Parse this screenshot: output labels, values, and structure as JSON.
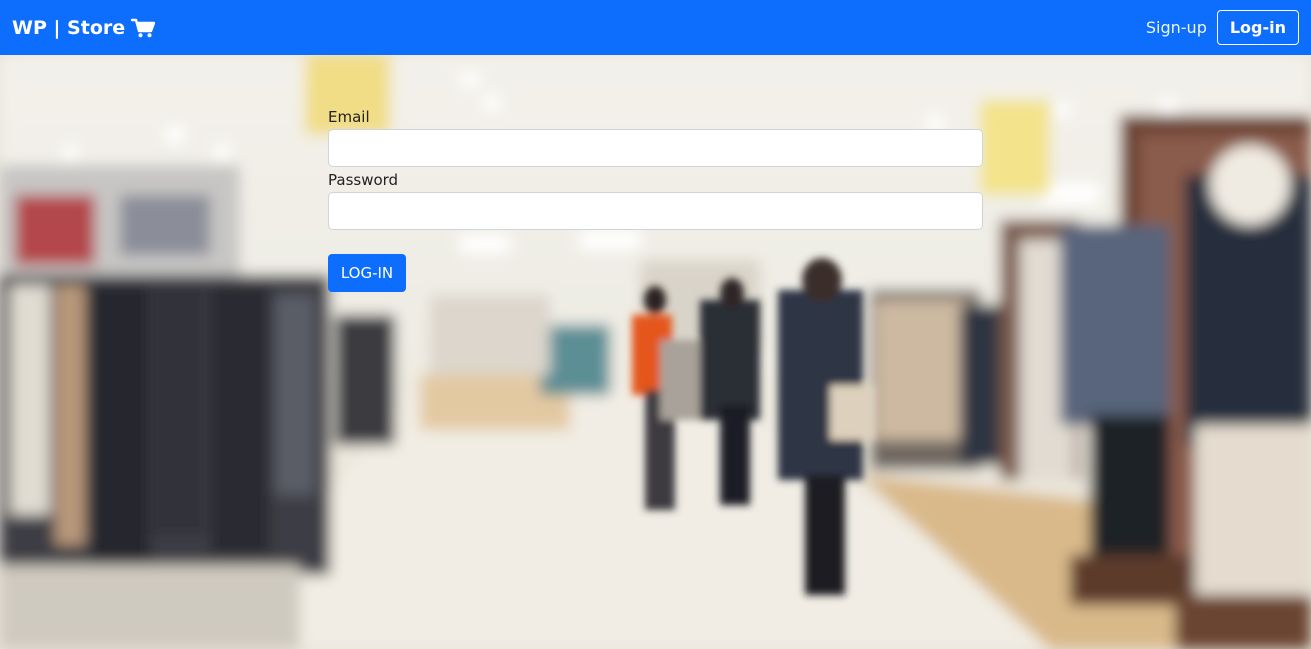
{
  "navbar": {
    "brand": "WP | Store",
    "brand_icon": "shopping-cart-icon",
    "signup_label": "Sign-up",
    "login_label": "Log-in",
    "background_color": "#0d6efd"
  },
  "form": {
    "email_label": "Email",
    "email_value": "",
    "password_label": "Password",
    "password_value": "",
    "submit_label": "LOG-IN",
    "submit_color": "#0d6efd"
  }
}
